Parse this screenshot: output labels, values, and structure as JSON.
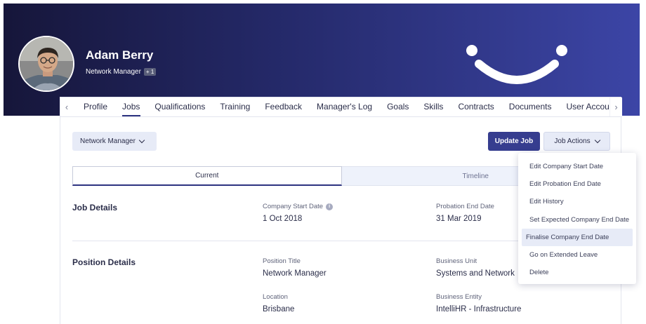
{
  "header": {
    "name": "Adam Berry",
    "role": "Network Manager",
    "role_extra": "+ 1",
    "brand_colors": {
      "banner_start": "#16163a",
      "banner_end": "#3c45a6",
      "primary_button": "#363d8f"
    }
  },
  "tabs": {
    "items": [
      "Profile",
      "Jobs",
      "Qualifications",
      "Training",
      "Feedback",
      "Manager's Log",
      "Goals",
      "Skills",
      "Contracts",
      "Documents",
      "User Account"
    ],
    "active": "Jobs",
    "left_arrow_icon": "chevron-left-icon",
    "right_arrow_icon": "chevron-right-icon"
  },
  "toolbar": {
    "job_select": "Network Manager",
    "update_label": "Update Job",
    "actions_label": "Job Actions"
  },
  "segment": {
    "current": "Current",
    "timeline": "Timeline"
  },
  "job_details": {
    "title": "Job Details",
    "start_label": "Company Start Date",
    "start_value": "1 Oct 2018",
    "probation_label": "Probation End Date",
    "probation_value": "31 Mar 2019"
  },
  "position_details": {
    "title": "Position Details",
    "position_title_label": "Position Title",
    "position_title_value": "Network Manager",
    "business_unit_label": "Business Unit",
    "business_unit_value": "Systems and Network",
    "location_label": "Location",
    "location_value": "Brisbane",
    "business_entity_label": "Business Entity",
    "business_entity_value": "IntelliHR - Infrastructure"
  },
  "actions_menu": {
    "items": [
      "Edit Company Start Date",
      "Edit Probation End Date",
      "Edit History",
      "Set Expected Company End Date",
      "Finalise Company End Date",
      "Go on Extended Leave",
      "Delete"
    ],
    "hovered": "Finalise Company End Date"
  }
}
